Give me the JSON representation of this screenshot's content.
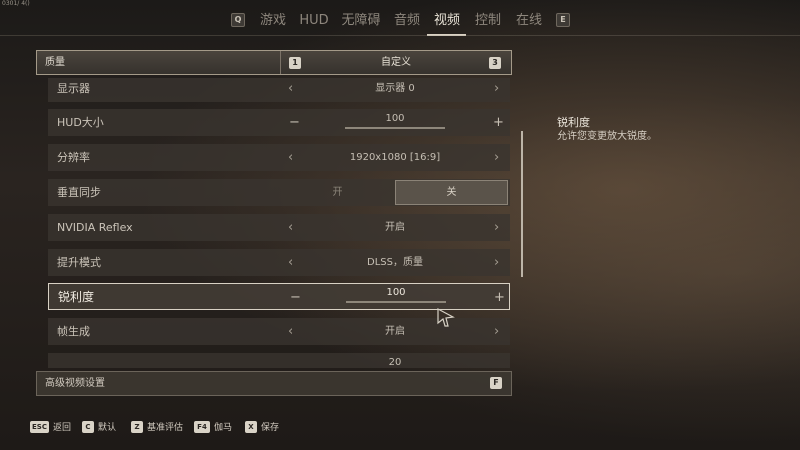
{
  "debug_text": "0301/ 4()",
  "nav": {
    "left_key": "Q",
    "right_key": "E",
    "tabs": [
      {
        "label": "游戏"
      },
      {
        "label": "HUD"
      },
      {
        "label": "无障碍"
      },
      {
        "label": "音频"
      },
      {
        "label": "视频",
        "active": true
      },
      {
        "label": "控制"
      },
      {
        "label": "在线"
      }
    ]
  },
  "quality": {
    "label": "质量",
    "value": "自定义",
    "key_left": "1",
    "key_right": "3"
  },
  "settings": [
    {
      "name": "显示器",
      "value": "显示器 0",
      "type": "select"
    },
    {
      "name": "HUD大小",
      "value": "100",
      "type": "slider"
    },
    {
      "name": "分辨率",
      "value": "1920x1080 [16:9]",
      "type": "select"
    },
    {
      "name": "垂直同步",
      "on_label": "开",
      "off_label": "关",
      "type": "toggle",
      "selected": "off"
    },
    {
      "name": "NVIDIA Reflex",
      "value": "开启",
      "type": "select"
    },
    {
      "name": "提升模式",
      "value": "DLSS，质量",
      "type": "select"
    },
    {
      "name": "锐利度",
      "value": "100",
      "type": "slider",
      "selected": true
    },
    {
      "name": "帧生成",
      "value": "开启",
      "type": "select"
    },
    {
      "name": "",
      "value": "20",
      "type": "slider"
    }
  ],
  "advanced": {
    "label": "高级视频设置",
    "key": "F"
  },
  "description": {
    "title": "锐利度",
    "text": "允许您变更放大锐度。"
  },
  "hints": [
    {
      "key": "ESC",
      "label": "返回"
    },
    {
      "key": "C",
      "label": "默认"
    },
    {
      "key": "Z",
      "label": "基准评估"
    },
    {
      "key": "F4",
      "label": "伽马"
    },
    {
      "key": "X",
      "label": "保存"
    }
  ],
  "colors": {
    "accent": "#d8d1c4",
    "row_bg": "#3a3530",
    "text": "#cbc4b9"
  }
}
